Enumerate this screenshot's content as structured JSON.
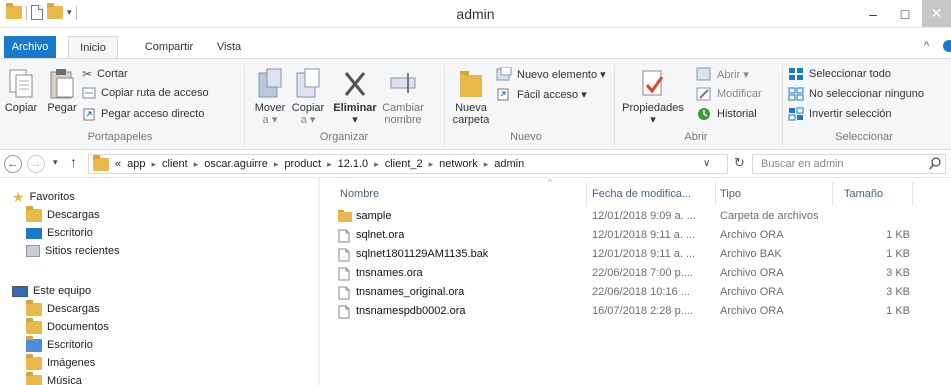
{
  "window": {
    "title": "admin",
    "minimize": "–",
    "maximize": "□",
    "close": "✕"
  },
  "tabs": {
    "archivo": "Archivo",
    "inicio": "Inicio",
    "compartir": "Compartir",
    "vista": "Vista",
    "minimize_ribbon": "^"
  },
  "ribbon": {
    "portapapeles": {
      "label": "Portapapeles",
      "copiar": "Copiar",
      "pegar": "Pegar",
      "cortar": "Cortar",
      "copiar_ruta": "Copiar ruta de acceso",
      "pegar_acceso": "Pegar acceso directo"
    },
    "organizar": {
      "label": "Organizar",
      "mover_1": "Mover",
      "mover_2": "a ▾",
      "copiar_1": "Copiar",
      "copiar_2": "a ▾",
      "eliminar": "Eliminar",
      "eliminar_drop": "▾",
      "cambiar_1": "Cambiar",
      "cambiar_2": "nombre"
    },
    "nuevo": {
      "label": "Nuevo",
      "nueva_1": "Nueva",
      "nueva_2": "carpeta",
      "nuevo_elemento": "Nuevo elemento ▾",
      "facil_acceso": "Fácil acceso ▾"
    },
    "abrir": {
      "label": "Abrir",
      "propiedades": "Propiedades",
      "propiedades_drop": "▾",
      "abrir": "Abrir ▾",
      "modificar": "Modificar",
      "historial": "Historial"
    },
    "seleccionar": {
      "label": "Seleccionar",
      "todo": "Seleccionar todo",
      "ninguno": "No seleccionar ninguno",
      "invertir": "Invertir selección"
    }
  },
  "address": {
    "crumbs": [
      "«",
      "app",
      "client",
      "oscar.aguirre",
      "product",
      "12.1.0",
      "client_2",
      "network",
      "admin"
    ],
    "search_placeholder": "Buscar en admin"
  },
  "nav": {
    "favoritos": "Favoritos",
    "descargas": "Descargas",
    "escritorio": "Escritorio",
    "sitios": "Sitios recientes",
    "equipo": "Este equipo",
    "eq_descargas": "Descargas",
    "documentos": "Documentos",
    "eq_escritorio": "Escritorio",
    "imagenes": "Imágenes",
    "musica": "Música"
  },
  "columns": {
    "name": "Nombre",
    "date": "Fecha de modifica...",
    "type": "Tipo",
    "size": "Tamaño"
  },
  "files": [
    {
      "name": "sample",
      "date": "12/01/2018 9:09 a. ...",
      "type": "Carpeta de archivos",
      "size": "",
      "icon": "folder-icon"
    },
    {
      "name": "sqlnet.ora",
      "date": "12/01/2018 9:11 a. ...",
      "type": "Archivo ORA",
      "size": "1 KB",
      "icon": "file-icon"
    },
    {
      "name": "sqlnet1801129AM1135.bak",
      "date": "12/01/2018 9:11 a. ...",
      "type": "Archivo BAK",
      "size": "1 KB",
      "icon": "file-icon"
    },
    {
      "name": "tnsnames.ora",
      "date": "22/06/2018 7:00 p....",
      "type": "Archivo ORA",
      "size": "3 KB",
      "icon": "file-icon"
    },
    {
      "name": "tnsnames_original.ora",
      "date": "22/06/2018 10:16 ...",
      "type": "Archivo ORA",
      "size": "3 KB",
      "icon": "file-icon"
    },
    {
      "name": "tnsnamespdb0002.ora",
      "date": "16/07/2018 2:28 p....",
      "type": "Archivo ORA",
      "size": "1 KB",
      "icon": "file-icon"
    }
  ],
  "colors": {
    "accent": "#1979ca",
    "folder": "#e8b84a",
    "column_header": "#4c607a"
  }
}
